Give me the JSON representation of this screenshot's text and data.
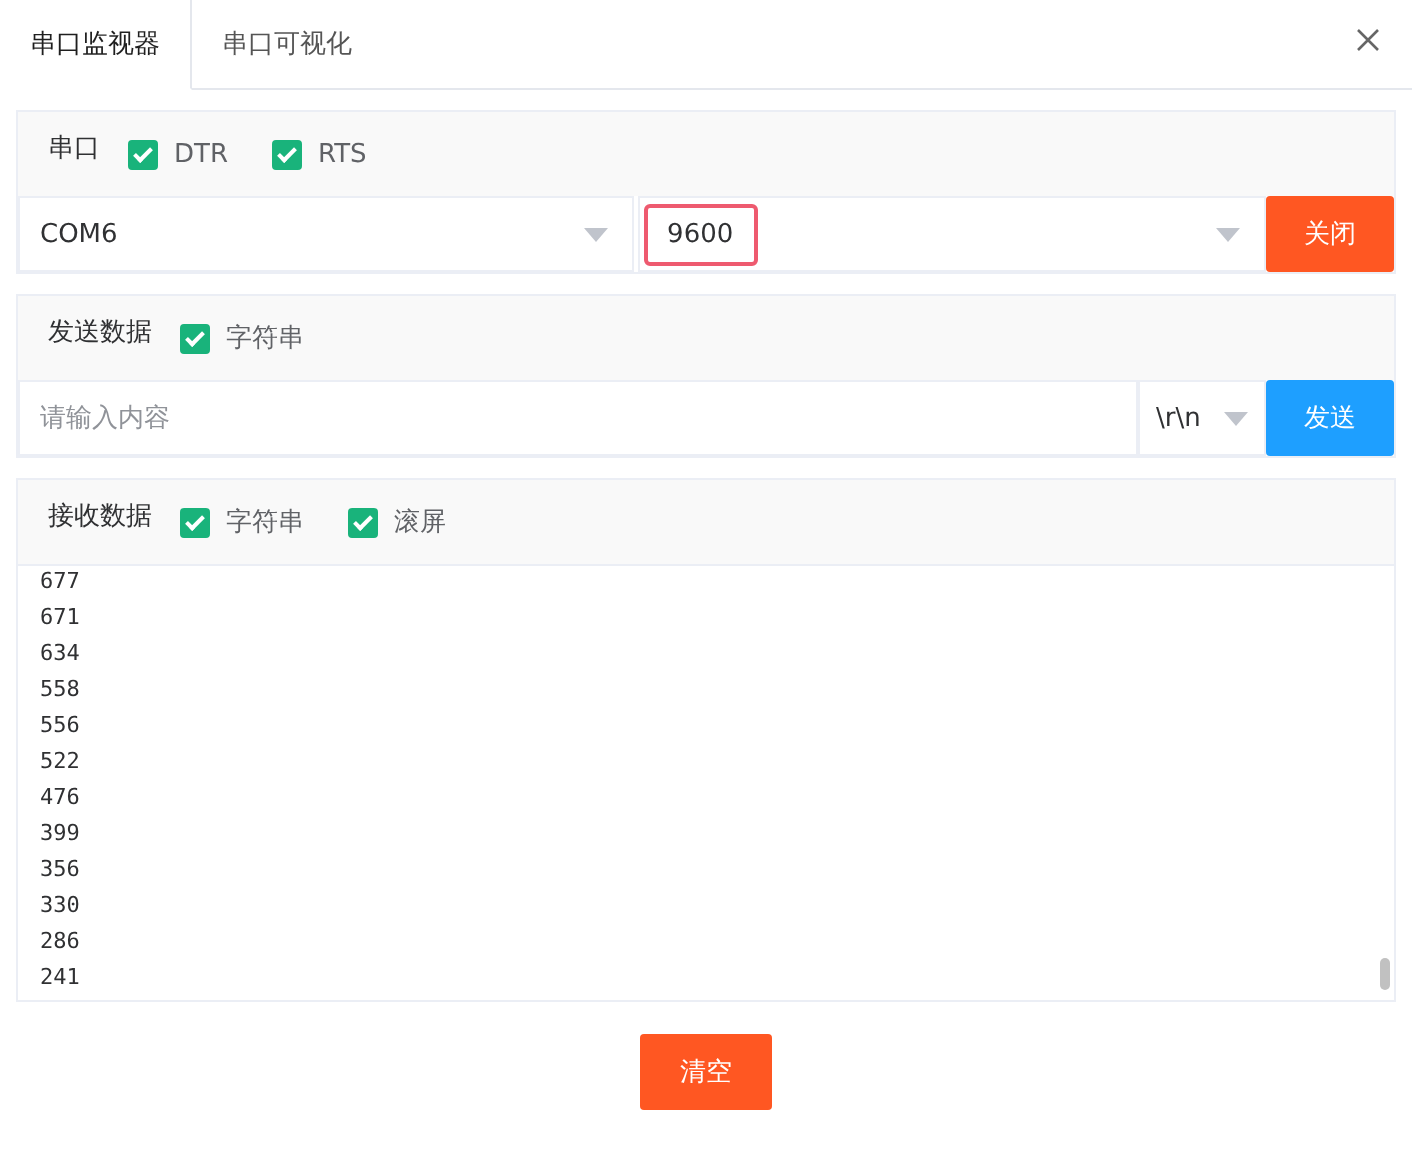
{
  "tabs": [
    {
      "label": "串口监视器",
      "selected": true
    },
    {
      "label": "串口可视化",
      "selected": false
    }
  ],
  "port_panel": {
    "title": "串口",
    "options": [
      {
        "label": "DTR",
        "checked": true
      },
      {
        "label": "RTS",
        "checked": true
      }
    ],
    "port": "COM6",
    "baud": {
      "value": "9600",
      "focused": true
    },
    "button": "关闭"
  },
  "send_panel": {
    "title": "发送数据",
    "options": [
      {
        "label": "字符串",
        "checked": true
      }
    ],
    "input": {
      "placeholder": "请输入内容"
    },
    "line_ending": "\\r\\n",
    "button": "发送"
  },
  "receive_panel": {
    "title": "接收数据",
    "options": [
      {
        "label": "字符串",
        "checked": true
      },
      {
        "label": "滚屏",
        "checked": true
      }
    ],
    "lines": [
      "677",
      "671",
      "634",
      "558",
      "556",
      "522",
      "476",
      "399",
      "356",
      "330",
      "286",
      "241"
    ]
  },
  "clear_button": "清空"
}
